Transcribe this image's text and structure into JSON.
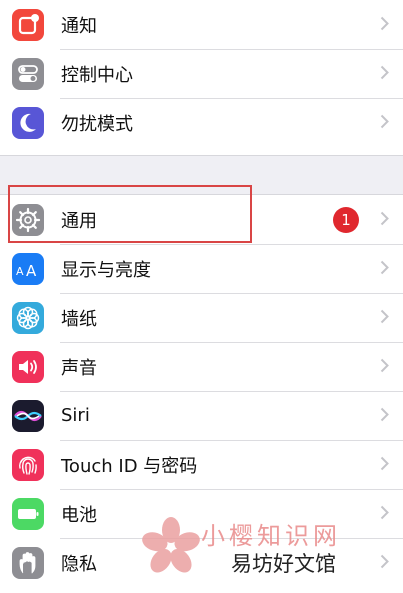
{
  "settings": {
    "items_top": [
      {
        "label": "通知",
        "icon": "notifications-icon",
        "color": "#f2473c"
      },
      {
        "label": "控制中心",
        "icon": "control-center-icon",
        "color": "#8e8e93"
      },
      {
        "label": "勿扰模式",
        "icon": "moon-icon",
        "color": "#5856d6"
      }
    ],
    "items_bottom": [
      {
        "label": "通用",
        "icon": "gear-icon",
        "color": "#8e8e93",
        "badge": "1"
      },
      {
        "label": "显示与亮度",
        "icon": "display-brightness-icon",
        "color": "#1a7cf5"
      },
      {
        "label": "墙纸",
        "icon": "wallpaper-icon",
        "color": "#34aadc"
      },
      {
        "label": "声音",
        "icon": "sound-icon",
        "color": "#f0315a"
      },
      {
        "label": "Siri",
        "icon": "siri-icon",
        "color": "#1b1b2e"
      },
      {
        "label": "Touch ID 与密码",
        "icon": "fingerprint-icon",
        "color": "#f0315a"
      },
      {
        "label": "电池",
        "icon": "battery-icon",
        "color": "#4cd964"
      },
      {
        "label": "隐私",
        "icon": "hand-icon",
        "color": "#8e8e93"
      }
    ]
  },
  "watermark": {
    "line1": "小樱知识网",
    "line2": "易坊好文馆"
  }
}
